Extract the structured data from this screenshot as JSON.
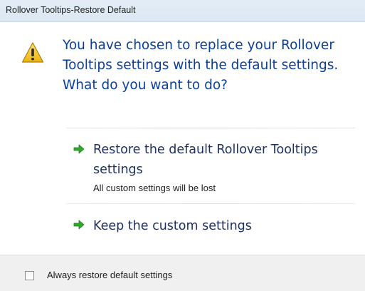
{
  "window": {
    "title": "Rollover Tooltips-Restore Default"
  },
  "content": {
    "icon": "warning-icon",
    "main_instruction": "You have chosen to replace your Rollover Tooltips settings with the default settings. What do you want to do?"
  },
  "command_links": [
    {
      "icon": "green-arrow-icon",
      "label": "Restore the default Rollover Tooltips settings",
      "note": "All custom settings will be lost"
    },
    {
      "icon": "green-arrow-icon",
      "label": "Keep the custom settings"
    }
  ],
  "footer": {
    "checkbox_label": "Always restore default settings",
    "checkbox_checked": false
  },
  "colors": {
    "instruction_text": "#0b3f9a",
    "command_text": "#1d2f5e",
    "arrow_green": "#2fa82c",
    "warning_yellow": "#f2c21a"
  }
}
